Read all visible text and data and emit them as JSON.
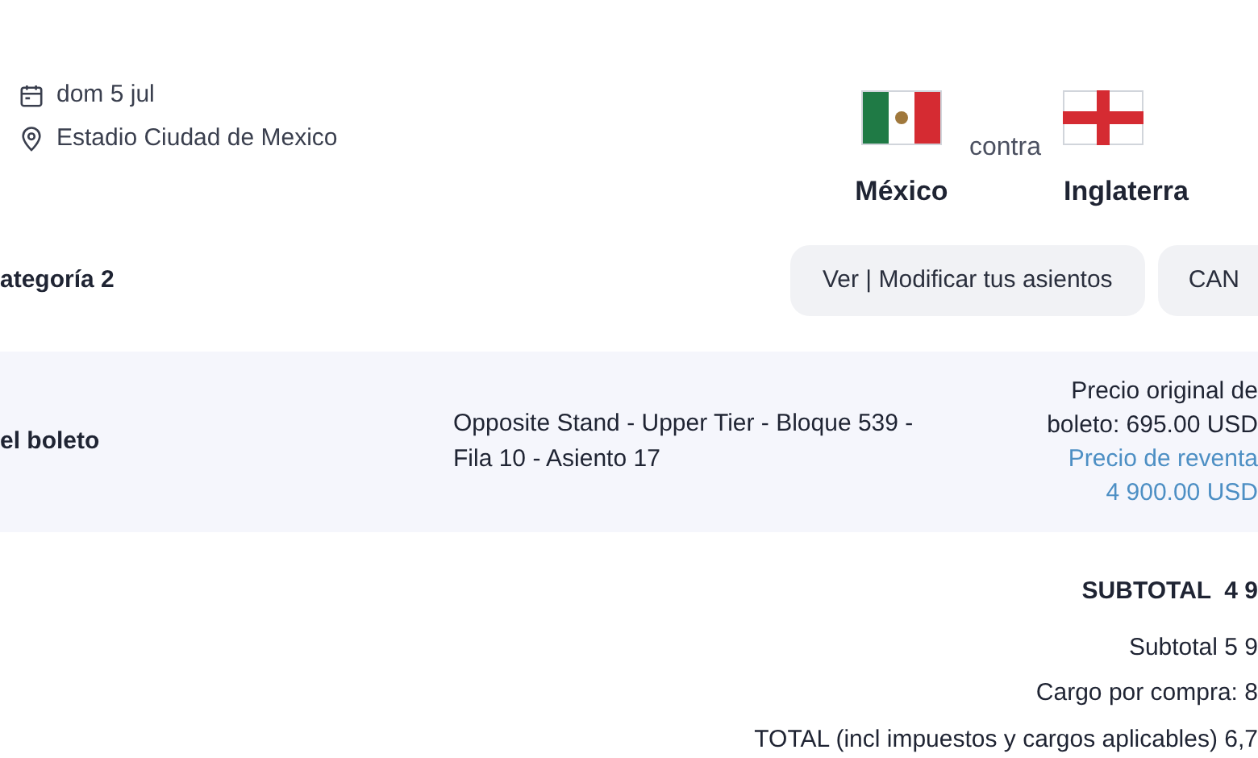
{
  "event": {
    "date": "dom 5 jul",
    "venue": "Estadio Ciudad de Mexico"
  },
  "match": {
    "home": {
      "name": "México",
      "kind": "mexico"
    },
    "versus": "contra",
    "away": {
      "name": "Inglaterra",
      "kind": "england"
    }
  },
  "category": {
    "label": "ategoría 2"
  },
  "buttons": [
    "Ver | Modificar tus asientos",
    "CAN"
  ],
  "ticket": {
    "label": "el boleto",
    "seat": "Opposite Stand - Upper Tier - Bloque 539 - Fila 10 - Asiento 17",
    "original_price": [
      "Precio original de",
      "boleto: 695.00 USD"
    ],
    "resale_price": [
      "Precio de reventa",
      "4 900.00 USD"
    ]
  },
  "totals": [
    {
      "kind": "header",
      "text": "SUBTOTAL  4 9"
    },
    {
      "kind": "line",
      "text": "Subtotal 5 9"
    },
    {
      "kind": "line",
      "text": "Cargo por compra: 8"
    },
    {
      "kind": "line",
      "text": "TOTAL (incl impuestos y cargos aplicables) 6,7"
    }
  ]
}
